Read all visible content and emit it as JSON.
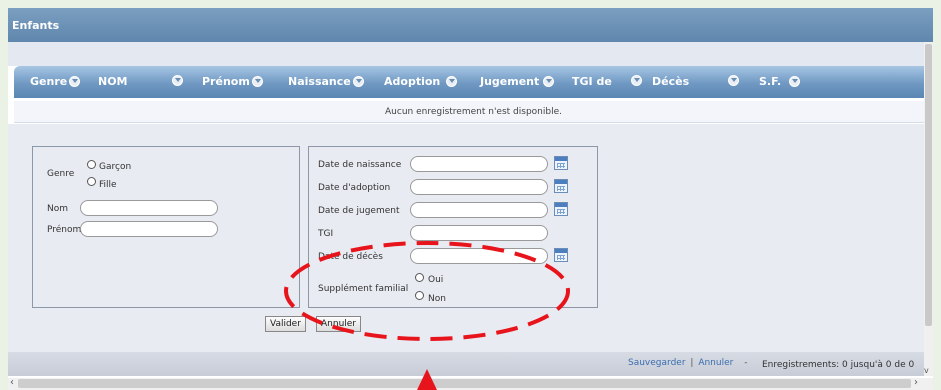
{
  "window": {
    "title": "Enfants"
  },
  "grid": {
    "columns": [
      "Genre",
      "NOM",
      "Prénom",
      "Naissance",
      "Adoption",
      "Jugement",
      "TGI de",
      "Décès",
      "S.F."
    ],
    "empty_message": "Aucun enregistrement n'est disponible."
  },
  "form": {
    "genre_label": "Genre",
    "genre_options": [
      "Garçon",
      "Fille"
    ],
    "nom_label": "Nom",
    "prenom_label": "Prénom",
    "date_naissance_label": "Date de naissance",
    "date_adoption_label": "Date d'adoption",
    "date_jugement_label": "Date de jugement",
    "tgi_label": "TGI",
    "date_deces_label": "Date de décès",
    "supplement_label": "Supplément familial",
    "supplement_options": [
      "Oui",
      "Non"
    ],
    "valider_label": "Valider",
    "annuler_label": "Annuler"
  },
  "footer": {
    "save_link": "Sauvegarder",
    "separator": "|",
    "cancel_link": "Annuler",
    "dash": "-",
    "records_text": "Enregistrements: 0 jusqu'à 0 de 0"
  },
  "scrollbars": {
    "left_arrow": "‹",
    "right_arrow": "›",
    "down_arrow": "v"
  },
  "annotation": {
    "color": "#e8141c",
    "shape": "dashed-ellipse",
    "pointer": "arrow-up"
  }
}
